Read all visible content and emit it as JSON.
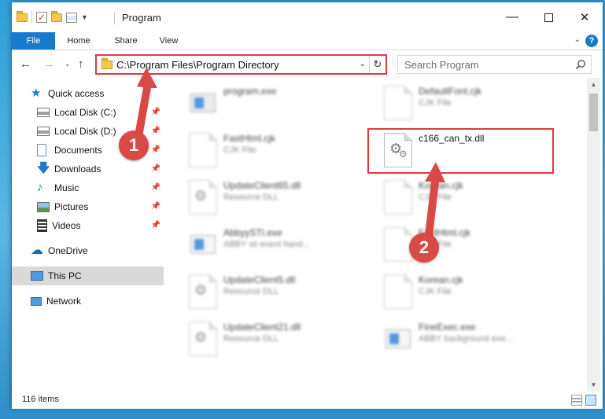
{
  "window": {
    "title": "Program",
    "ribbon_tabs": [
      "File",
      "Home",
      "Share",
      "View"
    ]
  },
  "address": {
    "path": "C:\\Program Files\\Program Directory"
  },
  "search": {
    "placeholder": "Search Program"
  },
  "sidebar": {
    "items": [
      {
        "label": "Quick access",
        "icon": "star-icon",
        "pinned": false
      },
      {
        "label": "Local Disk (C:)",
        "icon": "drive-icon",
        "pinned": true
      },
      {
        "label": "Local Disk (D:)",
        "icon": "drive-icon",
        "pinned": true
      },
      {
        "label": "Documents",
        "icon": "documents-icon",
        "pinned": true
      },
      {
        "label": "Downloads",
        "icon": "download-arrow-icon",
        "pinned": true
      },
      {
        "label": "Music",
        "icon": "music-note-icon",
        "pinned": true
      },
      {
        "label": "Pictures",
        "icon": "pictures-icon",
        "pinned": true
      },
      {
        "label": "Videos",
        "icon": "film-icon",
        "pinned": true
      },
      {
        "label": "OneDrive",
        "icon": "cloud-icon",
        "pinned": false
      },
      {
        "label": "This PC",
        "icon": "monitor-icon",
        "pinned": false,
        "selected": true
      },
      {
        "label": "Network",
        "icon": "network-icon",
        "pinned": false
      }
    ]
  },
  "files": [
    {
      "name": "program.exe",
      "type": "",
      "icon": "app-icon",
      "blurred": true
    },
    {
      "name": "DefaultFont.cjk",
      "type": "CJK File",
      "icon": "document-icon",
      "blurred": true
    },
    {
      "name": "FastHtml.cjk",
      "type": "CJK File",
      "icon": "document-icon",
      "blurred": true
    },
    {
      "name": "c166_can_tx.dll",
      "type": "",
      "icon": "dll-gear-icon",
      "blurred": false,
      "highlighted": true
    },
    {
      "name": "UpdateClient65.dll",
      "type": "Resource DLL",
      "icon": "dll-gear-icon",
      "blurred": true
    },
    {
      "name": "Korean.cjk",
      "type": "CJK File",
      "icon": "document-icon",
      "blurred": true
    },
    {
      "name": "AbbyySTI.exe",
      "type": "ABBY sti event hand...",
      "icon": "app-icon",
      "blurred": true
    },
    {
      "name": "FastHtml.cjk",
      "type": "CJK File",
      "icon": "document-icon",
      "blurred": true
    },
    {
      "name": "UpdateClient5.dll",
      "type": "Resource DLL",
      "icon": "dll-gear-icon",
      "blurred": true
    },
    {
      "name": "Korean.cjk",
      "type": "CJK File",
      "icon": "document-icon",
      "blurred": true
    },
    {
      "name": "UpdateClient21.dll",
      "type": "Resource DLL",
      "icon": "dll-gear-icon",
      "blurred": true
    },
    {
      "name": "FineExec.exe",
      "type": "ABBY background exe...",
      "icon": "app-icon",
      "blurred": true
    }
  ],
  "status": {
    "item_count": "116 items"
  },
  "callouts": [
    "1",
    "2"
  ],
  "colors": {
    "accent": "#1979ca",
    "highlight_border": "#e3383f",
    "callout_fill": "#d94a47"
  }
}
